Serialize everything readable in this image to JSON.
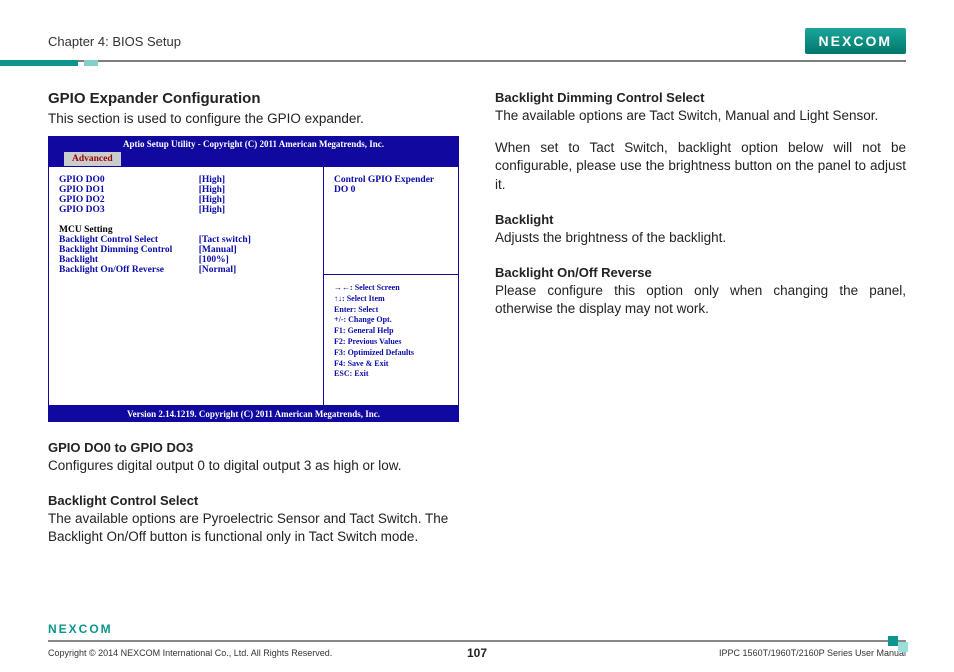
{
  "header": {
    "chapter": "Chapter 4: BIOS Setup",
    "brand": "NEXCOM"
  },
  "left": {
    "title": "GPIO Expander Configuration",
    "lede": "This section is used to configure the GPIO expander.",
    "bios": {
      "title": "Aptio Setup Utility - Copyright (C) 2011 American Megatrends, Inc.",
      "tab": "Advanced",
      "rows_group1": [
        {
          "name": "GPIO DO0",
          "value": "[High]"
        },
        {
          "name": "GPIO DO1",
          "value": "[High]"
        },
        {
          "name": "GPIO DO2",
          "value": "[High]"
        },
        {
          "name": "GPIO DO3",
          "value": "[High]"
        }
      ],
      "mcu_heading": "MCU Setting",
      "rows_group2": [
        {
          "name": "Backlight Control Select",
          "value": "[Tact switch]"
        },
        {
          "name": "Backlight Dimming Control",
          "value": "[Manual]"
        },
        {
          "name": "Backlight",
          "value": "[100%]"
        },
        {
          "name": "Backlight On/Off Reverse",
          "value": "[Normal]"
        }
      ],
      "help_text": "Control GPIO Expender DO 0",
      "keys": [
        "→←: Select Screen",
        "↑↓: Select Item",
        "Enter: Select",
        "+/-: Change Opt.",
        "F1: General Help",
        "F2: Previous Values",
        "F3: Optimized Defaults",
        "F4: Save & Exit",
        "ESC: Exit"
      ],
      "footer": "Version 2.14.1219. Copyright (C) 2011 American Megatrends, Inc."
    },
    "sub1_head": "GPIO DO0 to GPIO DO3",
    "sub1_text": "Configures digital output 0 to digital output 3 as high or low.",
    "sub2_head": "Backlight Control Select",
    "sub2_text": "The available options are Pyroelectric Sensor and Tact Switch. The Backlight On/Off button is functional only in Tact Switch mode."
  },
  "right": {
    "b1_head": "Backlight Dimming Control Select",
    "b1_text": "The available options are Tact Switch, Manual and Light Sensor.",
    "b1_text2": "When set to Tact Switch, backlight option below will not be configurable, please use the brightness button on the panel to adjust it.",
    "b2_head": "Backlight",
    "b2_text": "Adjusts the brightness of the backlight.",
    "b3_head": "Backlight On/Off Reverse",
    "b3_text": "Please configure this option only when changing the panel, otherwise the display may not work."
  },
  "footer": {
    "brand": "NEXCOM",
    "copyright": "Copyright © 2014 NEXCOM International Co., Ltd. All Rights Reserved.",
    "page": "107",
    "doc": "IPPC 1560T/1960T/2160P Series User Manual"
  }
}
